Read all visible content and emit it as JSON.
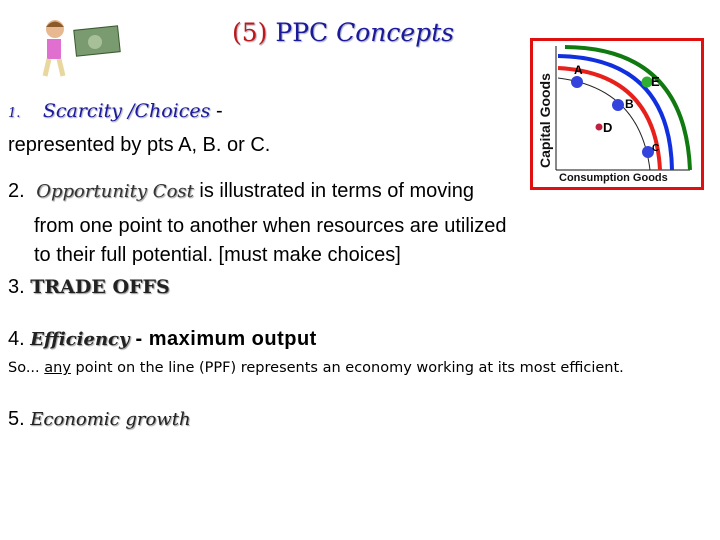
{
  "title": {
    "number": "(5)",
    "ppc": "PPC",
    "concepts": "Concepts"
  },
  "items": [
    {
      "num": "1.",
      "term": "Scarcity /Choices",
      "rest": " -",
      "line2": "represented by pts A, B. or C."
    },
    {
      "num": "2.",
      "term": "Opportunity Cost",
      "rest": " is illustrated in terms of moving",
      "line2": "from  one  point  to  another  when resources are utilized",
      "line3": "to their full potential. [must make choices]"
    },
    {
      "num": "3.",
      "term": "TRADE OFFS"
    },
    {
      "num": "4.",
      "term": "Efficiency",
      "rest": " -  maximum output",
      "note": "So... any point on the line (PPF) represents an economy working at its most efficient.",
      "note_prefix": "So... ",
      "note_em": "any",
      "note_suffix": " point on the line (PPF) represents an economy working at its most efficient."
    },
    {
      "num": "5.",
      "term": "Economic growth"
    }
  ],
  "chart": {
    "ylabel": "Capital Goods",
    "xlabel": "Consumption Goods",
    "points": [
      "A",
      "B",
      "C",
      "D",
      "E"
    ],
    "colors": {
      "frame": "#e01010",
      "red": "#e8201c",
      "blue": "#1030e0",
      "green": "#107a10",
      "point": "#3344dd",
      "pointD": "#c02040",
      "pointE": "#30b030"
    }
  }
}
